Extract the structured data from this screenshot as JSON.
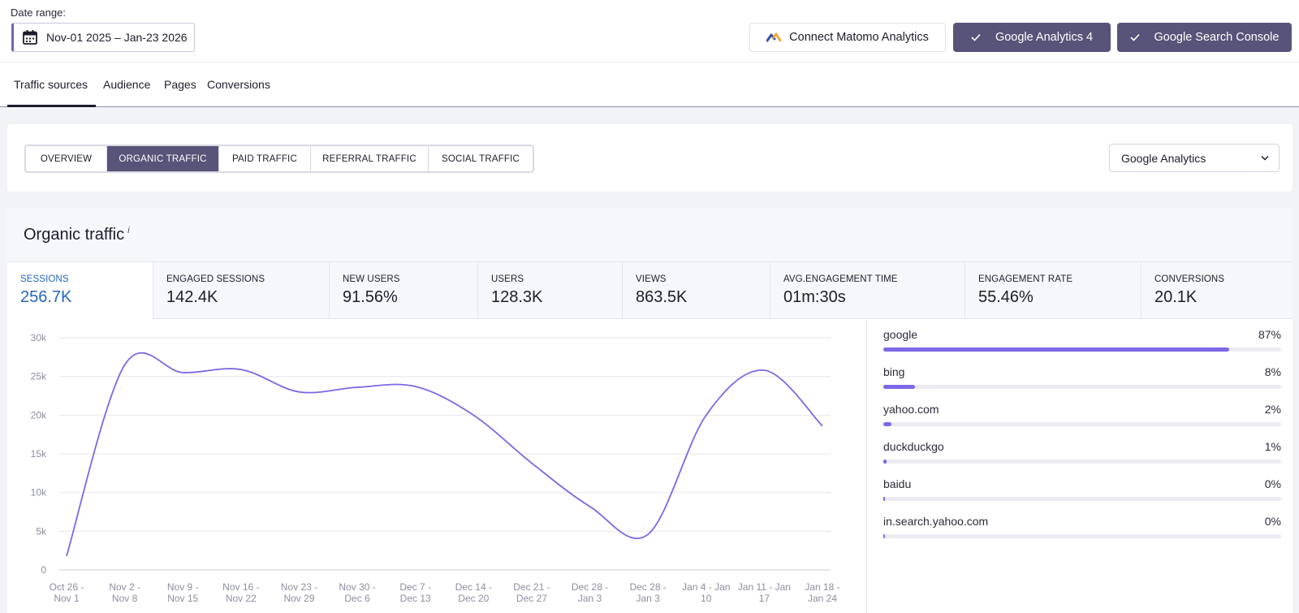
{
  "header": {
    "date_label": "Date range:",
    "date_value": "Nov-01 2025 – Jan-23 2026",
    "connect_matomo": "Connect Matomo Analytics",
    "ga4": "Google Analytics 4",
    "gsc": "Google Search Console"
  },
  "tabs": [
    {
      "label": "Traffic sources",
      "active": true
    },
    {
      "label": "Audience"
    },
    {
      "label": "Pages"
    },
    {
      "label": "Conversions"
    }
  ],
  "segments": [
    {
      "label": "OVERVIEW"
    },
    {
      "label": "ORGANIC TRAFFIC",
      "active": true
    },
    {
      "label": "PAID TRAFFIC"
    },
    {
      "label": "REFERRAL TRAFFIC"
    },
    {
      "label": "SOCIAL TRAFFIC"
    }
  ],
  "source_select": "Google Analytics",
  "card": {
    "title": "Organic traffic",
    "info": "i"
  },
  "metrics": [
    {
      "label": "SESSIONS",
      "value": "256.7K",
      "active": true
    },
    {
      "label": "ENGAGED SESSIONS",
      "value": "142.4K"
    },
    {
      "label": "NEW USERS",
      "value": "91.56%"
    },
    {
      "label": "USERS",
      "value": "128.3K"
    },
    {
      "label": "VIEWS",
      "value": "863.5K"
    },
    {
      "label": "AVG.ENGAGEMENT TIME",
      "value": "01m:30s"
    },
    {
      "label": "ENGAGEMENT RATE",
      "value": "55.46%"
    },
    {
      "label": "CONVERSIONS",
      "value": "20.1K"
    }
  ],
  "sources": [
    {
      "name": "google",
      "pct_label": "87%",
      "fill": 0.87
    },
    {
      "name": "bing",
      "pct_label": "8%",
      "fill": 0.08
    },
    {
      "name": "yahoo.com",
      "pct_label": "2%",
      "fill": 0.02
    },
    {
      "name": "duckduckgo",
      "pct_label": "1%",
      "fill": 0.008
    },
    {
      "name": "baidu",
      "pct_label": "0%",
      "fill": 0.003
    },
    {
      "name": "in.search.yahoo.com",
      "pct_label": "0%",
      "fill": 0.003
    }
  ],
  "colors": {
    "accent": "#585378",
    "line": "#7b69e6",
    "active_metric": "#2366c2"
  },
  "chart_data": {
    "type": "line",
    "categories": [
      [
        "Oct 26 -",
        "Nov 1"
      ],
      [
        "Nov 2 -",
        "Nov 8"
      ],
      [
        "Nov 9 -",
        "Nov 15"
      ],
      [
        "Nov 16 -",
        "Nov 22"
      ],
      [
        "Nov 23 -",
        "Nov 29"
      ],
      [
        "Nov 30 -",
        "Dec 6"
      ],
      [
        "Dec 7 -",
        "Dec 13"
      ],
      [
        "Dec 14 -",
        "Dec 20"
      ],
      [
        "Dec 21 -",
        "Dec 27"
      ],
      [
        "Dec 28 -",
        "Jan 3"
      ],
      [
        "Dec 28 -",
        "Jan 3"
      ],
      [
        "Jan 4 - Jan",
        "10"
      ],
      [
        "Jan 11 - Jan",
        "17"
      ],
      [
        "Jan 18 -",
        "Jan 24"
      ]
    ],
    "series": [
      {
        "values": [
          1800,
          26500,
          25500,
          25900,
          23000,
          23600,
          23700,
          20000,
          13800,
          8200,
          4600,
          20000,
          25800,
          18600
        ]
      }
    ],
    "ylim": [
      0,
      30000
    ],
    "yticks": [
      0,
      5000,
      10000,
      15000,
      20000,
      25000,
      30000
    ],
    "ytick_labels": [
      "0",
      "5k",
      "10k",
      "15k",
      "20k",
      "25k",
      "30k"
    ],
    "grid": true
  }
}
